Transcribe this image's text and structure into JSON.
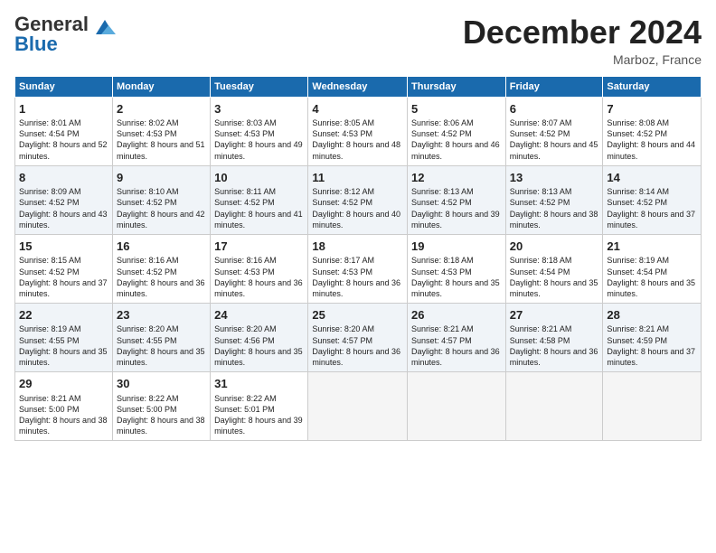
{
  "header": {
    "logo_general": "General",
    "logo_blue": "Blue",
    "month_title": "December 2024",
    "location": "Marboz, France"
  },
  "days_of_week": [
    "Sunday",
    "Monday",
    "Tuesday",
    "Wednesday",
    "Thursday",
    "Friday",
    "Saturday"
  ],
  "weeks": [
    [
      {
        "day": "1",
        "sunrise": "8:01 AM",
        "sunset": "4:54 PM",
        "daylight": "8 hours and 52 minutes."
      },
      {
        "day": "2",
        "sunrise": "8:02 AM",
        "sunset": "4:53 PM",
        "daylight": "8 hours and 51 minutes."
      },
      {
        "day": "3",
        "sunrise": "8:03 AM",
        "sunset": "4:53 PM",
        "daylight": "8 hours and 49 minutes."
      },
      {
        "day": "4",
        "sunrise": "8:05 AM",
        "sunset": "4:53 PM",
        "daylight": "8 hours and 48 minutes."
      },
      {
        "day": "5",
        "sunrise": "8:06 AM",
        "sunset": "4:52 PM",
        "daylight": "8 hours and 46 minutes."
      },
      {
        "day": "6",
        "sunrise": "8:07 AM",
        "sunset": "4:52 PM",
        "daylight": "8 hours and 45 minutes."
      },
      {
        "day": "7",
        "sunrise": "8:08 AM",
        "sunset": "4:52 PM",
        "daylight": "8 hours and 44 minutes."
      }
    ],
    [
      {
        "day": "8",
        "sunrise": "8:09 AM",
        "sunset": "4:52 PM",
        "daylight": "8 hours and 43 minutes."
      },
      {
        "day": "9",
        "sunrise": "8:10 AM",
        "sunset": "4:52 PM",
        "daylight": "8 hours and 42 minutes."
      },
      {
        "day": "10",
        "sunrise": "8:11 AM",
        "sunset": "4:52 PM",
        "daylight": "8 hours and 41 minutes."
      },
      {
        "day": "11",
        "sunrise": "8:12 AM",
        "sunset": "4:52 PM",
        "daylight": "8 hours and 40 minutes."
      },
      {
        "day": "12",
        "sunrise": "8:13 AM",
        "sunset": "4:52 PM",
        "daylight": "8 hours and 39 minutes."
      },
      {
        "day": "13",
        "sunrise": "8:13 AM",
        "sunset": "4:52 PM",
        "daylight": "8 hours and 38 minutes."
      },
      {
        "day": "14",
        "sunrise": "8:14 AM",
        "sunset": "4:52 PM",
        "daylight": "8 hours and 37 minutes."
      }
    ],
    [
      {
        "day": "15",
        "sunrise": "8:15 AM",
        "sunset": "4:52 PM",
        "daylight": "8 hours and 37 minutes."
      },
      {
        "day": "16",
        "sunrise": "8:16 AM",
        "sunset": "4:52 PM",
        "daylight": "8 hours and 36 minutes."
      },
      {
        "day": "17",
        "sunrise": "8:16 AM",
        "sunset": "4:53 PM",
        "daylight": "8 hours and 36 minutes."
      },
      {
        "day": "18",
        "sunrise": "8:17 AM",
        "sunset": "4:53 PM",
        "daylight": "8 hours and 36 minutes."
      },
      {
        "day": "19",
        "sunrise": "8:18 AM",
        "sunset": "4:53 PM",
        "daylight": "8 hours and 35 minutes."
      },
      {
        "day": "20",
        "sunrise": "8:18 AM",
        "sunset": "4:54 PM",
        "daylight": "8 hours and 35 minutes."
      },
      {
        "day": "21",
        "sunrise": "8:19 AM",
        "sunset": "4:54 PM",
        "daylight": "8 hours and 35 minutes."
      }
    ],
    [
      {
        "day": "22",
        "sunrise": "8:19 AM",
        "sunset": "4:55 PM",
        "daylight": "8 hours and 35 minutes."
      },
      {
        "day": "23",
        "sunrise": "8:20 AM",
        "sunset": "4:55 PM",
        "daylight": "8 hours and 35 minutes."
      },
      {
        "day": "24",
        "sunrise": "8:20 AM",
        "sunset": "4:56 PM",
        "daylight": "8 hours and 35 minutes."
      },
      {
        "day": "25",
        "sunrise": "8:20 AM",
        "sunset": "4:57 PM",
        "daylight": "8 hours and 36 minutes."
      },
      {
        "day": "26",
        "sunrise": "8:21 AM",
        "sunset": "4:57 PM",
        "daylight": "8 hours and 36 minutes."
      },
      {
        "day": "27",
        "sunrise": "8:21 AM",
        "sunset": "4:58 PM",
        "daylight": "8 hours and 36 minutes."
      },
      {
        "day": "28",
        "sunrise": "8:21 AM",
        "sunset": "4:59 PM",
        "daylight": "8 hours and 37 minutes."
      }
    ],
    [
      {
        "day": "29",
        "sunrise": "8:21 AM",
        "sunset": "5:00 PM",
        "daylight": "8 hours and 38 minutes."
      },
      {
        "day": "30",
        "sunrise": "8:22 AM",
        "sunset": "5:00 PM",
        "daylight": "8 hours and 38 minutes."
      },
      {
        "day": "31",
        "sunrise": "8:22 AM",
        "sunset": "5:01 PM",
        "daylight": "8 hours and 39 minutes."
      },
      null,
      null,
      null,
      null
    ]
  ]
}
